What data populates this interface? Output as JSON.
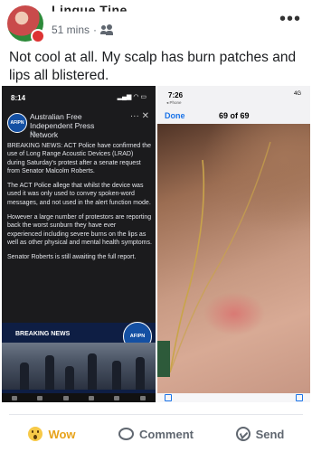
{
  "post": {
    "author": "Lingue Tine",
    "time": "51 mins",
    "caption": "Not cool at all. My scalp has burn patches and lips all blistered."
  },
  "left_screenshot": {
    "status_time": "8:14",
    "page_name": "Australian Free Independent Press Network",
    "page_time": "1h · ",
    "logo_text": "AFIPN",
    "controls": "···  ✕",
    "paragraphs": [
      "BREAKING NEWS: ACT Police have confirmed the use of Long Range Acoustic Devices (LRAD) during Saturday's protest after a senate request from Senator Malcolm Roberts.",
      "The ACT Police allege that whilst the device was used it was only used to convey spoken-word messages, and not used in the alert function mode.",
      "However a large number of protestors are reporting back the worst sunburn they have ever experienced including severe burns on the lips as well as other physical and mental health symptoms.",
      "Senator Roberts is still awaiting the full report."
    ],
    "banner_label": "BREAKING NEWS",
    "banner_logo": "AFIPN"
  },
  "right_screenshot": {
    "status_time": "7:26",
    "back_label": "◂ Phone",
    "status_right": "4G",
    "done_label": "Done",
    "counter": "69 of 69"
  },
  "actions": {
    "wow": "Wow",
    "comment": "Comment",
    "send": "Send"
  },
  "colors": {
    "wow": "#e7a21a",
    "link_blue": "#1a73e8",
    "news_navy": "#0e1e44"
  },
  "icons": [
    "friends-icon",
    "more-icon",
    "wow-icon",
    "comment-icon",
    "send-icon"
  ]
}
